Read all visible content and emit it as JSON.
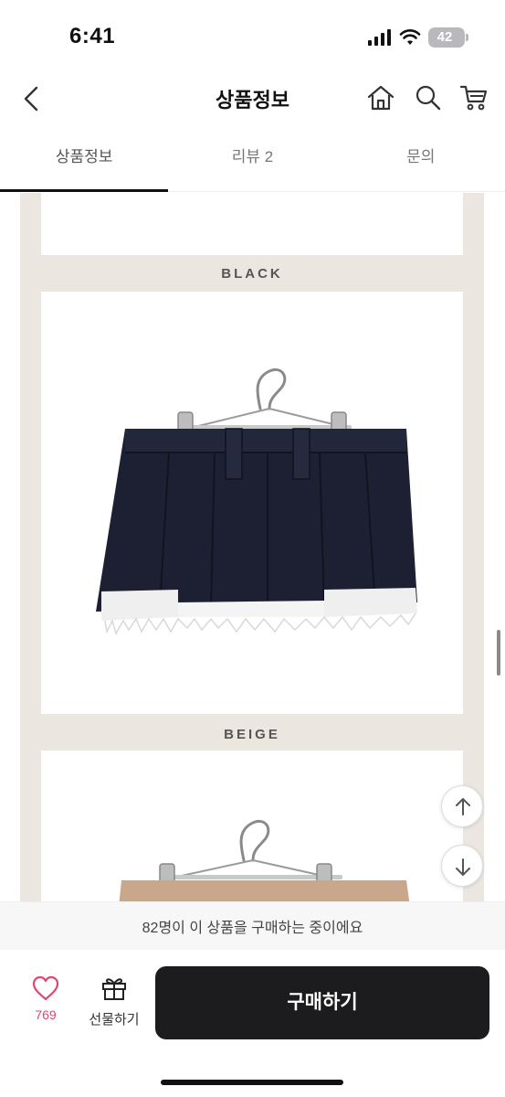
{
  "status": {
    "time": "6:41",
    "battery": "42"
  },
  "header": {
    "title": "상품정보"
  },
  "tabs": [
    {
      "label": "상품정보"
    },
    {
      "label": "리뷰 2"
    },
    {
      "label": "문의"
    }
  ],
  "content": {
    "labels": {
      "black": "BLACK",
      "beige": "BEIGE"
    }
  },
  "bottom": {
    "notice": "82명이 이 상품을 구매하는 중이에요",
    "like_count": "769",
    "gift_label": "선물하기",
    "buy_label": "구매하기"
  },
  "colors": {
    "accent_heart": "#e0466f",
    "buy_button": "#1c1c1e",
    "frame_bg": "#ece6e0"
  },
  "icons": [
    "back-icon",
    "home-icon",
    "search-icon",
    "cart-icon",
    "heart-icon",
    "gift-icon",
    "arrow-up-icon",
    "arrow-down-icon",
    "signal-icon",
    "wifi-icon",
    "battery-icon"
  ]
}
